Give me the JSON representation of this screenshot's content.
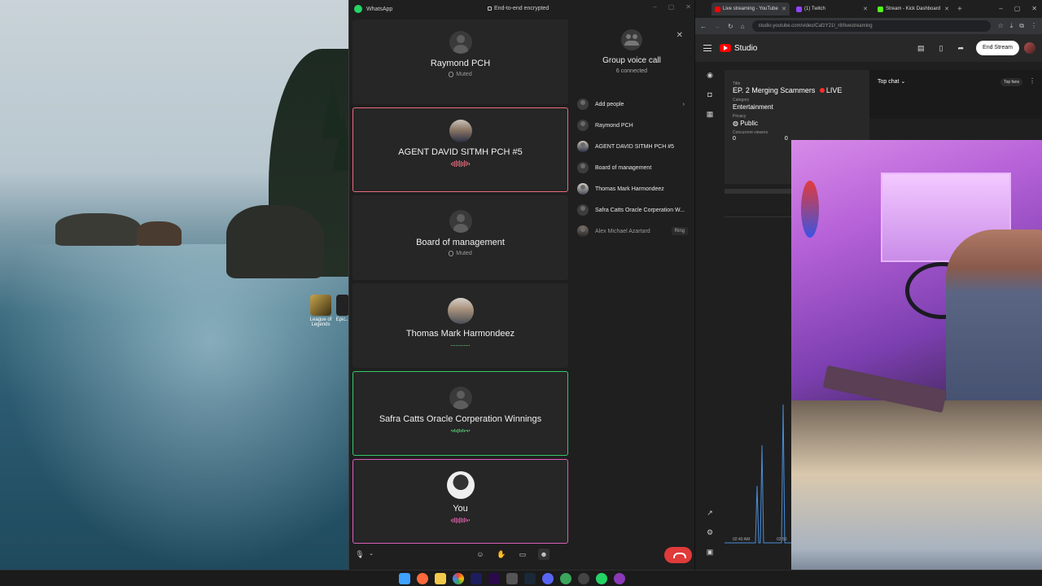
{
  "desktop": {
    "icons": [
      {
        "label": "League of Legends",
        "icon": "league-icon"
      },
      {
        "label": "Epic...",
        "icon": "epic-icon"
      }
    ]
  },
  "whatsapp": {
    "app_title": "WhatsApp",
    "encryption": "End-to-end encrypted",
    "tiles": [
      {
        "name": "Raymond PCH",
        "status": "Muted",
        "state": "muted"
      },
      {
        "name": "AGENT DAVID SITMH PCH #5",
        "status": "",
        "state": "speaking"
      },
      {
        "name": "Board of management",
        "status": "Muted",
        "state": "muted"
      },
      {
        "name": "Thomas Mark Harmondeez",
        "status": "",
        "state": "idle"
      },
      {
        "name": "Safra Catts Oracle Corperation Winnings",
        "status": "",
        "state": "speaking"
      },
      {
        "name": "You",
        "status": "",
        "state": "speaking"
      }
    ],
    "panel": {
      "title": "Group voice call",
      "connected": "6 connected",
      "add_people": "Add people",
      "participants": [
        "Raymond PCH",
        "AGENT DAVID SITMH PCH #5",
        "Board of management",
        "Thomas Mark Harmondeez",
        "Safra Catts Oracle Corperation W...",
        "Alex Michael Azartard"
      ],
      "ring_label": "Ring"
    }
  },
  "browser": {
    "tabs": [
      {
        "label": "Live streaming - YouTube",
        "color": "#ff0000"
      },
      {
        "label": "(1) Twitch",
        "color": "#9146ff"
      },
      {
        "label": "Stream - Kick Dashboard",
        "color": "#53fc18"
      }
    ],
    "url": "studio.youtube.com/video/CafzY21I_r8/livestreaming",
    "studio": {
      "brand": "Studio",
      "end_stream": "End Stream",
      "title_label": "Title",
      "title": "EP. 2 Merging Scammers",
      "live": "LIVE",
      "category_label": "Category",
      "category": "Entertainment",
      "privacy_label": "Privacy",
      "privacy": "Public",
      "viewers_label": "Concurrent viewers",
      "viewers": "0",
      "likes_value": "0",
      "chat_mode": "Top chat",
      "top_fans": "Top fans",
      "time_start": "02:40 AM",
      "time_next": "02:50"
    }
  },
  "colors": {
    "accent_whatsapp": "#25d366",
    "speaking_red": "#e96b7d",
    "speaking_green": "#35c96a",
    "speaking_pink": "#d95fb9",
    "end_call": "#e03a3a"
  }
}
